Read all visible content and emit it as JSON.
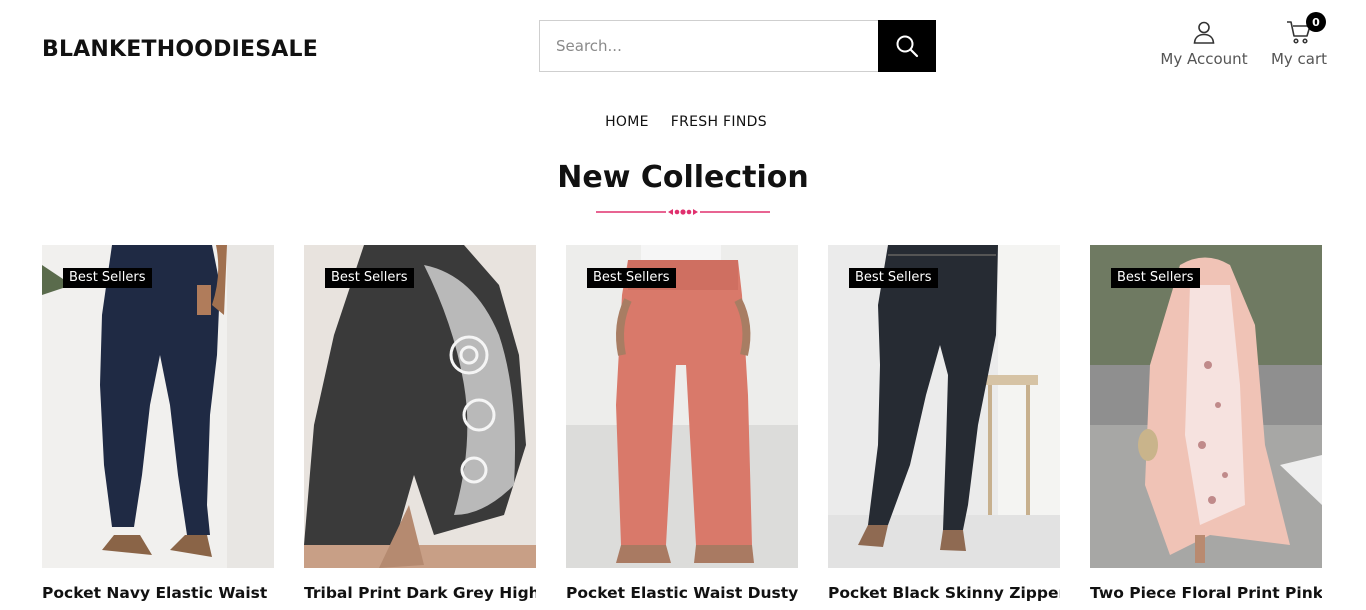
{
  "header": {
    "logo": "BLANKETHOODIESALE",
    "search": {
      "placeholder": "Search...",
      "value": ""
    },
    "account_label": "My Account",
    "cart_label": "My cart",
    "cart_count": "0"
  },
  "nav": {
    "items": [
      {
        "label": "HOME"
      },
      {
        "label": "FRESH FINDS"
      }
    ]
  },
  "section": {
    "title": "New Collection",
    "divider_color": "#e0306e"
  },
  "products": [
    {
      "badge": "Best Sellers",
      "title": "Pocket Navy Elastic Waist High",
      "image_icon": "navy-pants-image"
    },
    {
      "badge": "Best Sellers",
      "title": "Tribal Print Dark Grey High",
      "image_icon": "tribal-shorts-image"
    },
    {
      "badge": "Best Sellers",
      "title": "Pocket Elastic Waist Dusty Pink",
      "image_icon": "pink-pants-image"
    },
    {
      "badge": "Best Sellers",
      "title": "Pocket Black Skinny Zipper Fly",
      "image_icon": "black-jeans-image"
    },
    {
      "badge": "Best Sellers",
      "title": "Two Piece Floral Print Pink",
      "image_icon": "floral-dress-image"
    }
  ],
  "colors": {
    "accent": "#e0306e",
    "badge_bg": "#000000",
    "search_button_bg": "#000000"
  }
}
